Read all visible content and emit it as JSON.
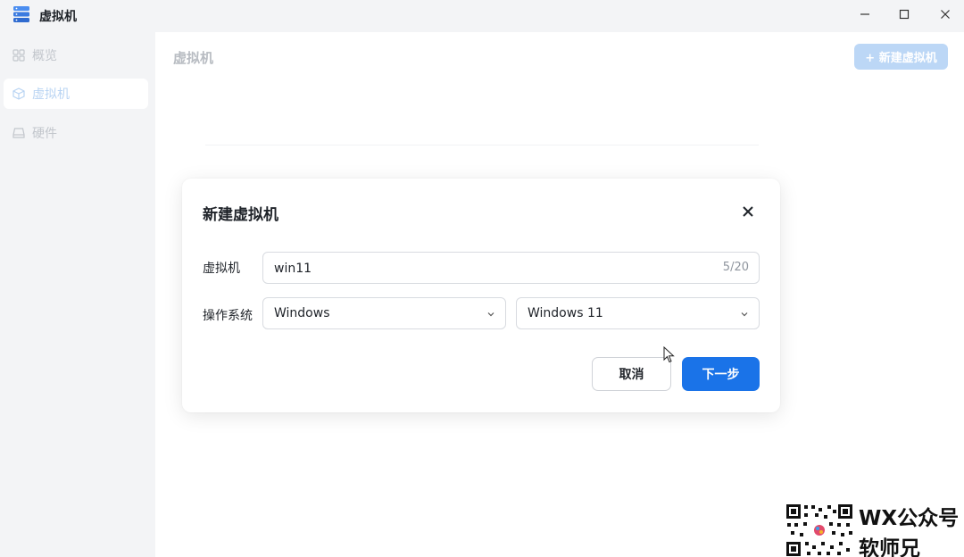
{
  "window": {
    "title": "虚拟机",
    "controls": {
      "minimize": "minimize-icon",
      "maximize": "maximize-icon",
      "close": "close-icon"
    }
  },
  "sidebar": {
    "items": [
      {
        "label": "概览",
        "icon": "grid-icon",
        "active": false
      },
      {
        "label": "虚拟机",
        "icon": "cube-icon",
        "active": true
      },
      {
        "label": "硬件",
        "icon": "drive-icon",
        "active": false
      }
    ]
  },
  "main": {
    "title": "虚拟机",
    "new_button_label": "+ 新建虚拟机"
  },
  "dialog": {
    "title": "新建虚拟机",
    "vm_label": "虚拟机",
    "vm_name_value": "win11",
    "vm_name_counter": "5/20",
    "os_label": "操作系统",
    "os_select_value": "Windows",
    "version_select_value": "Windows 11",
    "cancel_label": "取消",
    "next_label": "下一步"
  },
  "watermark": {
    "line1": "WX公众号",
    "line2": "软师兄"
  },
  "colors": {
    "primary": "#1a73e8",
    "primary_disabled": "#bcd7f6",
    "sidebar_bg": "#f3f4f6"
  }
}
